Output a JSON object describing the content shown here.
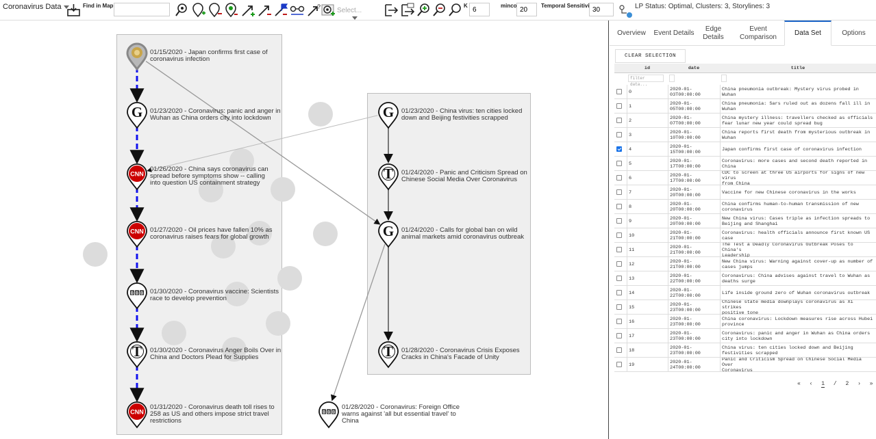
{
  "toolbar": {
    "dataset_label": "Coronavirus Data",
    "find_in_map": "Find in Map",
    "search_value": "",
    "select_placeholder": "Select...",
    "k_label": "K",
    "k_value": "6",
    "mincover_label": "mincover",
    "mincover_value": "20",
    "temporal_label": "Temporal Sensitivity",
    "temporal_value": "30",
    "status_text": "LP Status: Optimal, Clusters: 3, Storylines: 3"
  },
  "events": [
    {
      "source": "bbc-gold",
      "text": [
        "01/15/2020 - Japan confirms first case of",
        "coronavirus infection"
      ]
    },
    {
      "source": "guardian",
      "text": [
        "01/23/2020 - Coronavirus: panic and anger in",
        "Wuhan as China orders city into lockdown"
      ]
    },
    {
      "source": "cnn",
      "text": [
        "01/26/2020 - China says coronavirus can",
        "spread before symptoms show -- calling",
        "into question US containment strategy"
      ]
    },
    {
      "source": "cnn",
      "text": [
        "01/27/2020 - Oil prices have fallen 10% as",
        "coronavirus raises fears for global growth"
      ]
    },
    {
      "source": "bbc",
      "text": [
        "01/30/2020 - Coronavirus vaccine: Scientists",
        "race to develop prevention"
      ]
    },
    {
      "source": "nyt",
      "text": [
        "01/30/2020 - Coronavirus Anger Boils Over in",
        "China and Doctors Plead for Supplies"
      ]
    },
    {
      "source": "cnn",
      "text": [
        "01/31/2020 - Coronavirus death toll rises to",
        "258 as US and others impose strict travel",
        "restrictions"
      ]
    },
    {
      "source": "guardian",
      "text": [
        "01/23/2020 - China virus: ten cities locked",
        "down and Beijing festivities scrapped"
      ]
    },
    {
      "source": "nyt",
      "text": [
        "01/24/2020 - Panic and Criticism Spread on",
        "Chinese Social Media Over Coronavirus"
      ]
    },
    {
      "source": "guardian",
      "text": [
        "01/24/2020 - Calls for global ban on wild",
        "animal markets amid coronavirus outbreak"
      ]
    },
    {
      "source": "nyt",
      "text": [
        "01/28/2020 - Coronavirus Crisis Exposes",
        "Cracks in China's Facade of Unity"
      ]
    },
    {
      "source": "bbc",
      "text": [
        "01/28/2020 - Coronavirus: Foreign Office",
        "warns against 'all but essential travel' to",
        "China"
      ]
    }
  ],
  "colors": {
    "main_story_edge": "#1111ee",
    "edge": "#999999",
    "storyline_bg": "#efefef",
    "tab_accent": "#1a63c7",
    "checkbox": "#1a73e8"
  },
  "tabs": [
    {
      "label": "Overview",
      "active": false
    },
    {
      "label": "Event Details",
      "active": false
    },
    {
      "label": "Edge Details",
      "active": false
    },
    {
      "label": "Event Comparison",
      "active": false
    },
    {
      "label": "Data Set",
      "active": true
    },
    {
      "label": "Options",
      "active": false
    }
  ],
  "clear_selection": "CLEAR SELECTION",
  "table": {
    "headers": [
      "id",
      "date",
      "title"
    ],
    "filter_placeholder": "filter data...",
    "rows": [
      {
        "id": "0",
        "date": [
          "2020-01-",
          "03T00:00:00"
        ],
        "title": [
          "China pneumonia outbreak: Mystery virus probed in Wuhan"
        ],
        "checked": false
      },
      {
        "id": "1",
        "date": [
          "2020-01-",
          "05T00:00:00"
        ],
        "title": [
          "China pneumonia: Sars ruled out as dozens fall ill in",
          "Wuhan"
        ],
        "checked": false
      },
      {
        "id": "2",
        "date": [
          "2020-01-",
          "07T00:00:00"
        ],
        "title": [
          "China mystery illness: travellers checked as officials",
          "fear lunar new year could spread bug"
        ],
        "checked": false
      },
      {
        "id": "3",
        "date": [
          "2020-01-",
          "10T00:00:00"
        ],
        "title": [
          "China reports first death from mysterious outbreak in",
          "Wuhan"
        ],
        "checked": false
      },
      {
        "id": "4",
        "date": [
          "2020-01-",
          "15T00:00:00"
        ],
        "title": [
          "Japan confirms first case of coronavirus infection"
        ],
        "checked": true
      },
      {
        "id": "5",
        "date": [
          "2020-01-",
          "17T00:00:00"
        ],
        "title": [
          "Coronavirus: more cases and second death reported in",
          "China"
        ],
        "checked": false
      },
      {
        "id": "6",
        "date": [
          "2020-01-",
          "17T00:00:00"
        ],
        "title": [
          "CDC to screen at three US airports for signs of new virus",
          "from China"
        ],
        "checked": false
      },
      {
        "id": "7",
        "date": [
          "2020-01-",
          "20T00:00:00"
        ],
        "title": [
          "Vaccine for new Chinese coronavirus in the works"
        ],
        "checked": false
      },
      {
        "id": "8",
        "date": [
          "2020-01-",
          "20T00:00:00"
        ],
        "title": [
          "China confirms human-to-human transmission of new",
          "coronavirus"
        ],
        "checked": false
      },
      {
        "id": "9",
        "date": [
          "2020-01-",
          "20T00:00:00"
        ],
        "title": [
          "New China virus: Cases triple as infection spreads to",
          "Beijing and Shanghai"
        ],
        "checked": false
      },
      {
        "id": "10",
        "date": [
          "2020-01-",
          "21T00:00:00"
        ],
        "title": [
          "Coronavirus: health officials announce first known US",
          "case"
        ],
        "checked": false
      },
      {
        "id": "11",
        "date": [
          "2020-01-",
          "21T00:00:00"
        ],
        "title": [
          "The Test a Deadly Coronavirus Outbreak Poses to China's",
          "Leadership"
        ],
        "checked": false
      },
      {
        "id": "12",
        "date": [
          "2020-01-",
          "21T00:00:00"
        ],
        "title": [
          "New China virus: Warning against cover-up as number of",
          "cases jumps"
        ],
        "checked": false
      },
      {
        "id": "13",
        "date": [
          "2020-01-",
          "22T00:00:00"
        ],
        "title": [
          "Coronavirus: China advises against travel to Wuhan as",
          "deaths surge"
        ],
        "checked": false
      },
      {
        "id": "14",
        "date": [
          "2020-01-",
          "22T00:00:00"
        ],
        "title": [
          "Life inside ground zero of Wuhan coronavirus outbreak"
        ],
        "checked": false
      },
      {
        "id": "15",
        "date": [
          "2020-01-",
          "23T00:00:00"
        ],
        "title": [
          "Chinese state media downplays coronavirus as Xi strikes",
          "positive tone"
        ],
        "checked": false
      },
      {
        "id": "16",
        "date": [
          "2020-01-",
          "23T00:00:00"
        ],
        "title": [
          "China coronavirus: Lockdown measures rise across Hubei",
          "province"
        ],
        "checked": false
      },
      {
        "id": "17",
        "date": [
          "2020-01-",
          "23T00:00:00"
        ],
        "title": [
          "Coronavirus: panic and anger in Wuhan as China orders",
          "city into lockdown"
        ],
        "checked": false
      },
      {
        "id": "18",
        "date": [
          "2020-01-",
          "23T00:00:00"
        ],
        "title": [
          "China virus: ten cities locked down and Beijing",
          "festivities scrapped"
        ],
        "checked": false
      },
      {
        "id": "19",
        "date": [
          "2020-01-",
          "24T00:00:00"
        ],
        "title": [
          "Panic and Criticism Spread on Chinese Social Media Over",
          "Coronavirus"
        ],
        "checked": false
      }
    ]
  },
  "pager": {
    "first": "«",
    "prev": "‹",
    "current": "1",
    "sep": "/",
    "total": "2",
    "next": "›",
    "last": "»"
  }
}
